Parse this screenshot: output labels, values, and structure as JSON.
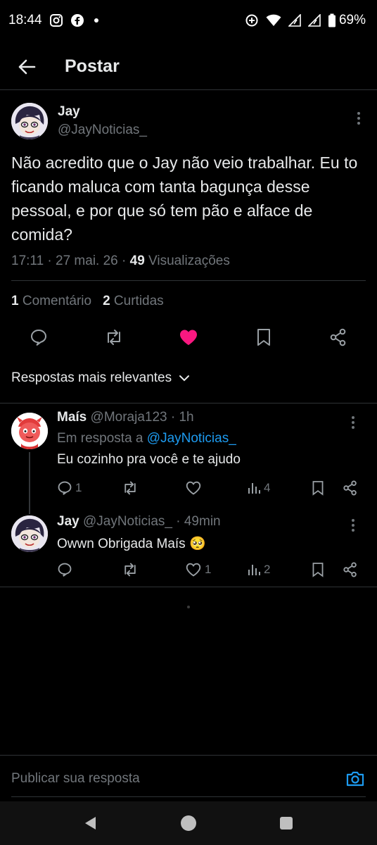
{
  "status_bar": {
    "time": "18:44",
    "battery": "69%"
  },
  "header": {
    "title": "Postar"
  },
  "post": {
    "display_name": "Jay",
    "handle": "@JayNoticias_",
    "text": "Não acredito que o Jay não veio trabalhar. Eu to ficando maluca com tanta bagunça desse pessoal, e por que só tem pão e alface de comida?",
    "time": "17:11 · 27 mai. 26 · ",
    "views_count": "49",
    "views_label": " Visualizações",
    "comments_count": "1",
    "comments_label": " Comentário",
    "likes_count": "2",
    "likes_label": " Curtidas",
    "liked": true,
    "like_color": "#f91880"
  },
  "replies_filter": {
    "label": "Respostas mais relevantes"
  },
  "replies": [
    {
      "display_name": "Maís",
      "handle": "@Moraja123",
      "age": " · 1h",
      "replying_to_prefix": "Em resposta a ",
      "replying_to": "@JayNoticias_",
      "text": "Eu cozinho pra você e te ajudo",
      "comments": "1",
      "retweets": "",
      "likes": "",
      "views": "4"
    },
    {
      "display_name": "Jay",
      "handle": "@JayNoticias_",
      "age": " · 49min",
      "text": "Owwn Obrigada Maís 🥺",
      "comments": "",
      "retweets": "",
      "likes": "1",
      "views": "2"
    }
  ],
  "composer": {
    "placeholder": "Publicar sua resposta"
  },
  "colors": {
    "accent": "#1d9bf0",
    "secondary_text": "#71767b",
    "like": "#f91880"
  }
}
